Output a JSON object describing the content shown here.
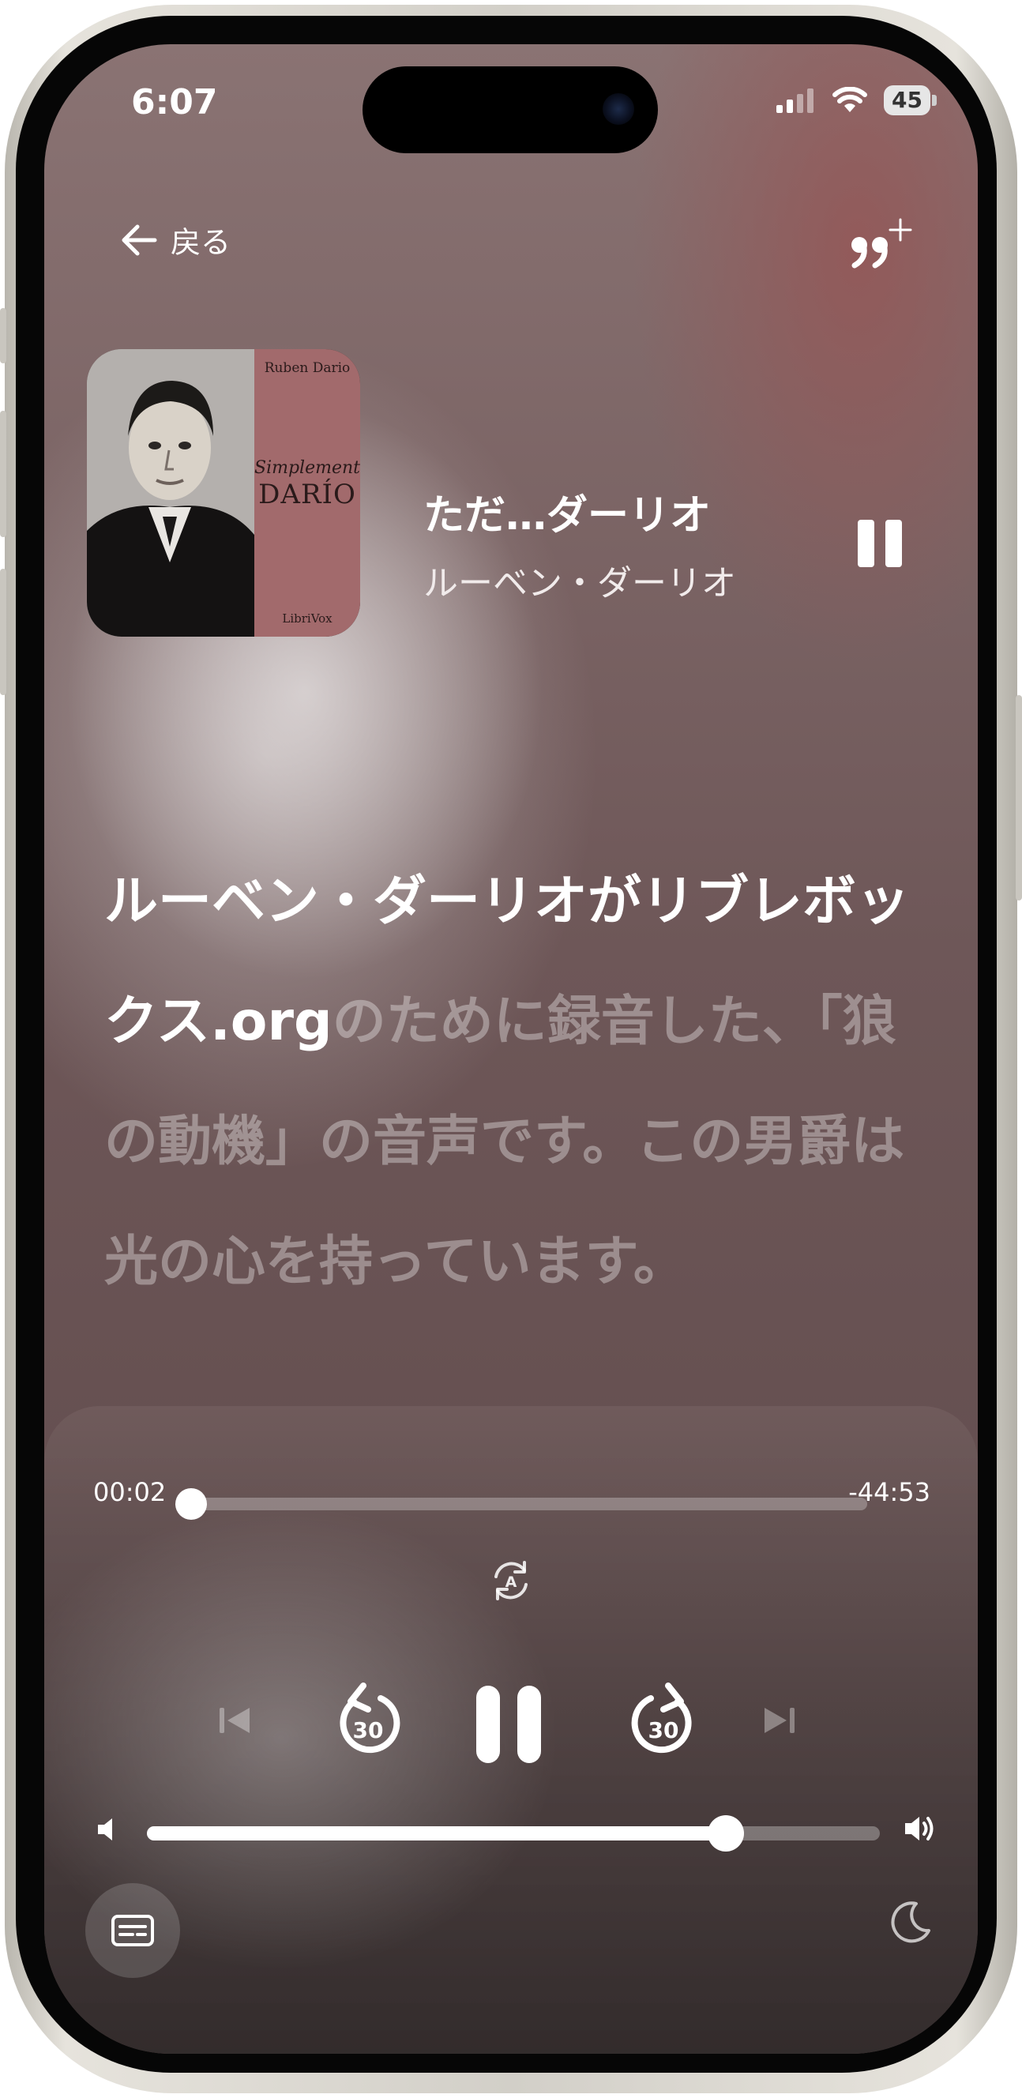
{
  "status_bar": {
    "time": "6:07",
    "battery": "45"
  },
  "nav": {
    "back_label": "戻る"
  },
  "book": {
    "title": "ただ…ダーリオ",
    "author": "ルーベン・ダーリオ",
    "cover": {
      "author": "Ruben Dario",
      "subtitle": "Simplemente",
      "title": "DARÍO",
      "publisher": "LibriVox"
    }
  },
  "transcript": {
    "spoken": "ルーベン・ダーリオがリブレボックス.org",
    "upcoming": "のために録音した、「狼の動機」の音声です。この男爵は光の心を持っています。"
  },
  "player": {
    "elapsed": "00:02",
    "remaining": "-44:53",
    "progress_fraction": 0.0,
    "volume_fraction": 0.79,
    "skip_back_seconds": "30",
    "skip_forward_seconds": "30",
    "autoplay_badge": "A"
  },
  "icons": [
    "arrow-left-icon",
    "quote-plus-icon",
    "pause-icon",
    "autoplay-icon",
    "previous-track-icon",
    "rewind-30-icon",
    "forward-30-icon",
    "next-track-icon",
    "volume-low-icon",
    "volume-high-icon",
    "subtitles-icon",
    "moon-icon",
    "signal-icon",
    "wifi-icon",
    "battery-icon"
  ]
}
